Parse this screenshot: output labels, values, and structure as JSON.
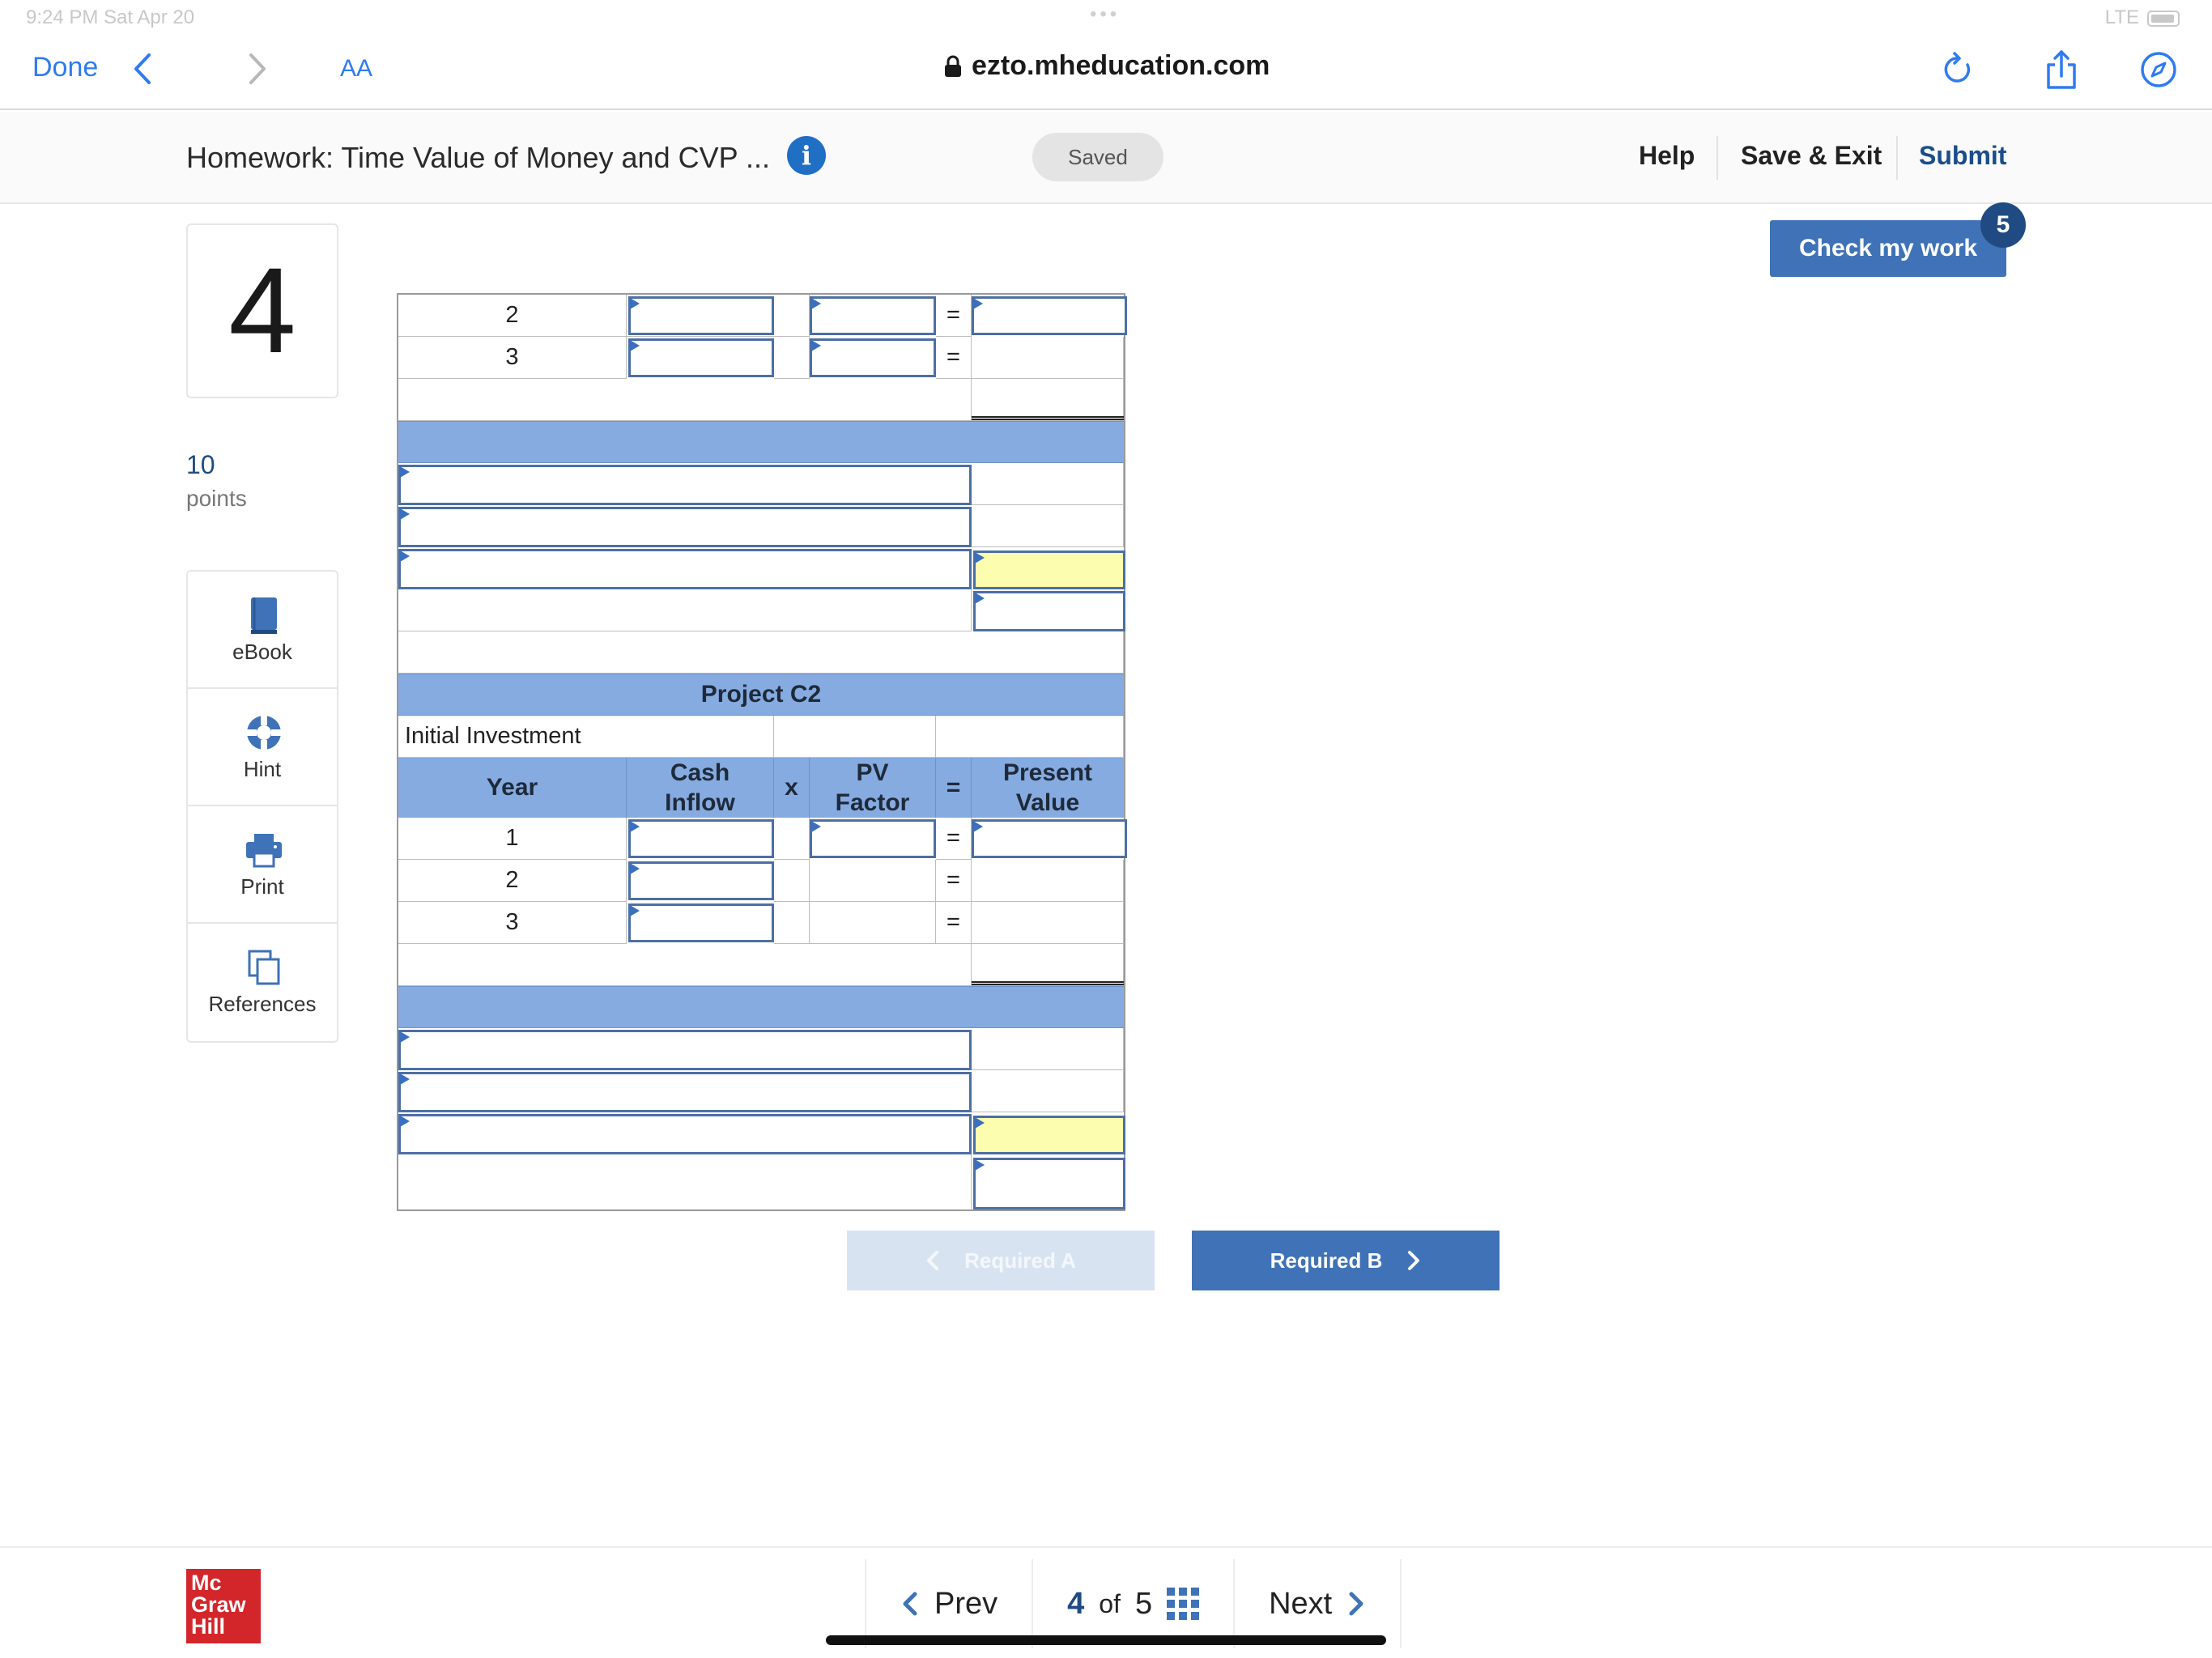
{
  "status": {
    "time": "9:24 PM   Sat Apr 20",
    "signal": "LTE"
  },
  "browser": {
    "done_label": "Done",
    "text_size_label": "AA",
    "url": "ezto.mheducation.com"
  },
  "assignment": {
    "title": "Homework: Time Value of Money and CVP ...",
    "saved_label": "Saved",
    "help_label": "Help",
    "save_exit_label": "Save & Exit",
    "submit_label": "Submit"
  },
  "question": {
    "number": "4",
    "points_value": "10",
    "points_label": "points"
  },
  "tools": [
    {
      "label": "eBook",
      "icon": "book-icon"
    },
    {
      "label": "Hint",
      "icon": "lifebuoy-icon"
    },
    {
      "label": "Print",
      "icon": "printer-icon"
    },
    {
      "label": "References",
      "icon": "copy-pages-icon"
    }
  ],
  "check_work": {
    "label": "Check my work",
    "badge": "5"
  },
  "worksheet": {
    "top_rows": [
      {
        "year": "2"
      },
      {
        "year": "3"
      }
    ],
    "equals": "=",
    "project_c2": {
      "title": "Project C2",
      "initial_investment_label": "Initial Investment",
      "headers": {
        "year": "Year",
        "cash_inflow": "Cash\nInflow",
        "times": "x",
        "pv_factor": "PV\nFactor",
        "equals": "=",
        "present_value": "Present\nValue"
      },
      "rows": [
        {
          "year": "1"
        },
        {
          "year": "2"
        },
        {
          "year": "3"
        }
      ]
    }
  },
  "required_nav": {
    "prev_label": "Required A",
    "next_label": "Required B"
  },
  "footer": {
    "logo_lines": [
      "Mc",
      "Graw",
      "Hill"
    ],
    "prev_label": "Prev",
    "current": "4",
    "of_label": "of",
    "total": "5",
    "next_label": "Next"
  },
  "colors": {
    "accent": "#3f72b6",
    "band": "#86abe0",
    "highlight": "#fdfdb0",
    "logo": "#d3262b"
  }
}
